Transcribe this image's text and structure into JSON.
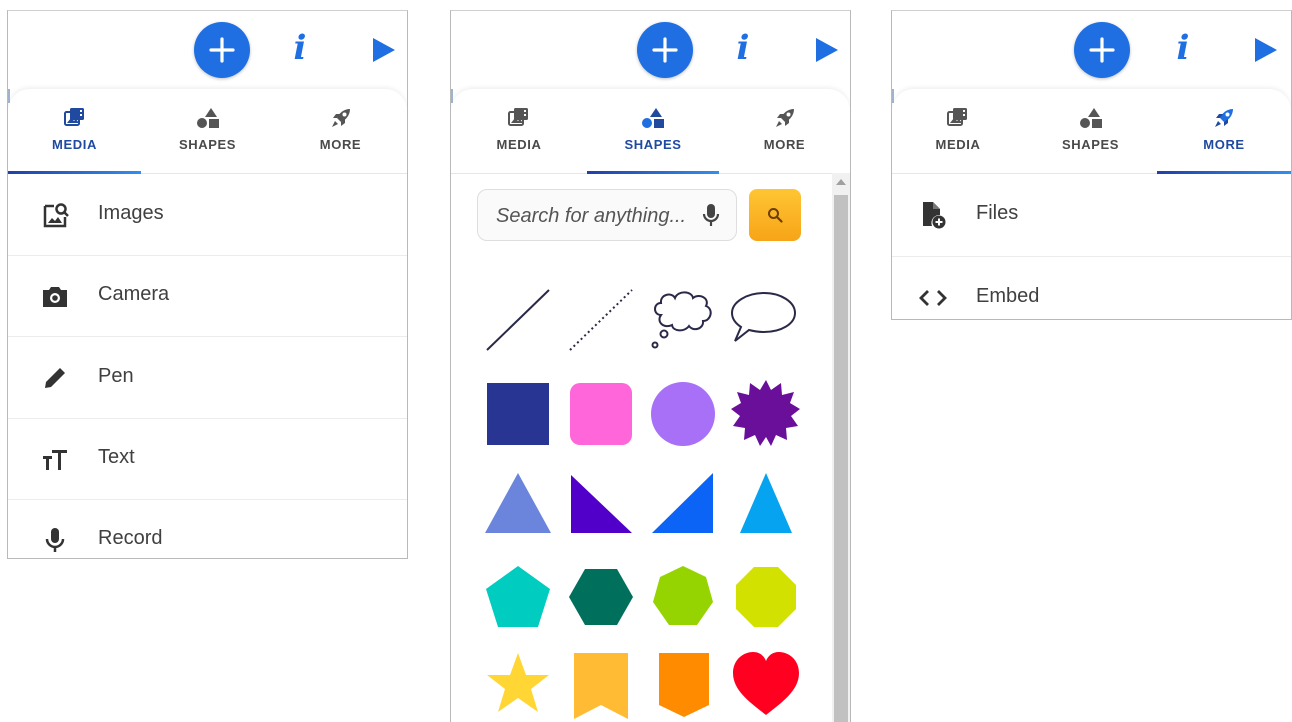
{
  "toolbar": {
    "info_glyph": "i"
  },
  "tabs": {
    "media": "MEDIA",
    "shapes": "SHAPES",
    "more": "MORE"
  },
  "media_items": [
    {
      "label": "Images",
      "icon": "image-search-icon"
    },
    {
      "label": "Camera",
      "icon": "camera-icon"
    },
    {
      "label": "Pen",
      "icon": "pen-icon"
    },
    {
      "label": "Text",
      "icon": "text-size-icon"
    },
    {
      "label": "Record",
      "icon": "microphone-icon"
    }
  ],
  "shapes_panel": {
    "search_placeholder": "Search for anything..."
  },
  "more_items": [
    {
      "label": "Files",
      "icon": "file-add-icon"
    },
    {
      "label": "Embed",
      "icon": "code-icon"
    }
  ],
  "colors": {
    "accent_blue": "#1f6fe3",
    "tab_active": "#1f4aa0",
    "search_button": "#fbb226",
    "square": "#283593",
    "rounded_square": "#ff66d9",
    "circle": "#a770f7",
    "burst": "#6a0f9a",
    "triangle_1": "#6b84dc",
    "triangle_2": "#5000c8",
    "triangle_3": "#0b64f5",
    "triangle_4": "#06a3f0",
    "pentagon": "#00ccbf",
    "hexagon": "#00705c",
    "heptagon": "#95d400",
    "octagon": "#d2e100",
    "star": "#ffd633",
    "banner": "#ffbb33",
    "shield": "#ff8b00",
    "heart": "#ff0021"
  }
}
